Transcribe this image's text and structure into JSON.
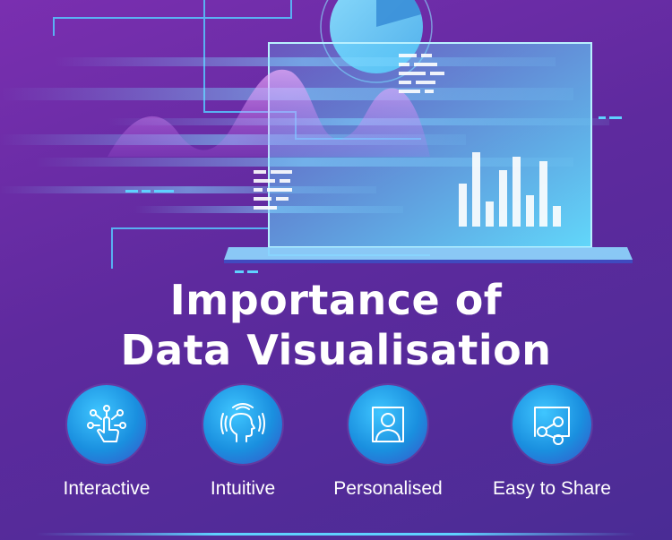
{
  "title": {
    "line1": "Importance of",
    "line2": "Data Visualisation"
  },
  "features": [
    {
      "label": "Interactive",
      "icon": "touch-network-icon"
    },
    {
      "label": "Intuitive",
      "icon": "head-signal-icon"
    },
    {
      "label": "Personalised",
      "icon": "user-profile-icon"
    },
    {
      "label": "Easy to Share",
      "icon": "share-icon"
    }
  ],
  "colors": {
    "background": "#5e2a9e",
    "accent": "#5fd1ff",
    "icon_circle": "#1a8fdf",
    "text": "#ffffff"
  }
}
